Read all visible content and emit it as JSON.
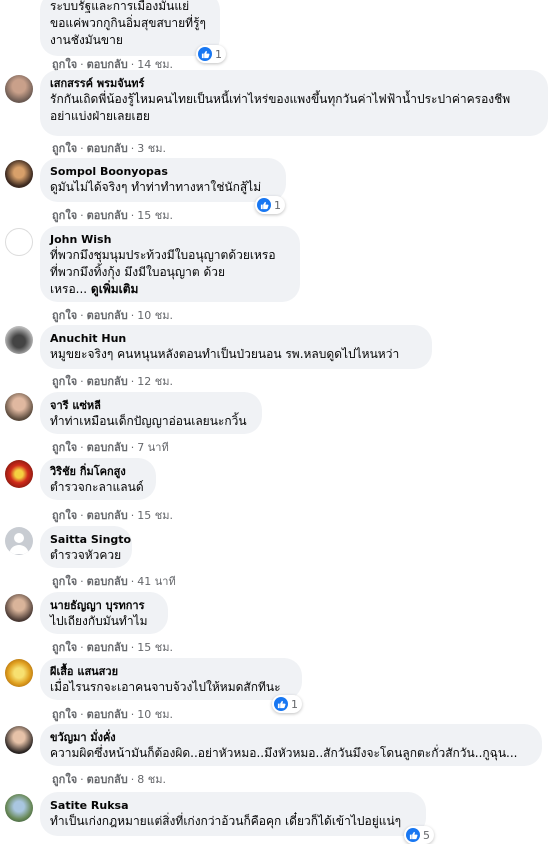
{
  "actions": {
    "like": "ถูกใจ",
    "reply": "ตอบกลับ",
    "dot": "·"
  },
  "comments": [
    {
      "name": "",
      "text": "ระบบรัฐและการเมืองมันแย่\nขอแค่พวกกูกินอิ่มสุขสบายที่รู้ๆ\nงานชังมันขาย",
      "time": "14 ชม.",
      "reactions": "1"
    },
    {
      "name": "เสกสรรค์ พรมจันทร์",
      "text": "รักกันเถิดพี่น้องรู้ไหมคนไทยเป็นหนี้เท่าไหร่ของแพงขึ้นทุกวันค่าไฟฟ้าน้ำประปาค่าครองชีพ\nอย่าแบ่งฝ่ายเลยเฮย",
      "time": "3 ชม."
    },
    {
      "name": "Sompol Boonyopas",
      "text": "ดูมันไม่ได้จริงๆ ทำท่าทำทางหาใช่นักสู้ไม่",
      "time": "15 ชม.",
      "reactions": "1"
    },
    {
      "name": "John Wish",
      "text": "ที่พวกมึงชุมนุมประท้วงมีใบอนุญาตด้วยเหรอ\nที่พวกมึงทิ้งกุ้ง มึงมีใบอนุญาต ด้วย\nเหรอ... ",
      "more": "ดูเพิ่มเติม",
      "time": "10 ชม."
    },
    {
      "name": "Anuchit Hun",
      "text": "หมูขยะจริงๆ คนหนุนหลังตอนทำเป็นป่วยนอน รพ.หลบดูดไปไหนหว่า",
      "time": "12 ชม."
    },
    {
      "name": "จารี แซ่หลี",
      "text": "ทำท่าเหมือนเด็กปัญญาอ่อนเลยนะกวิ้น",
      "time": "7 นาที"
    },
    {
      "name": "วิริชัย กิ่มโคกสูง",
      "text": "ตำรวจกะลาแลนด์",
      "time": "15 ชม."
    },
    {
      "name": "Saitta Singto",
      "text": "ตำรวจหัวควย",
      "time": "41 นาที"
    },
    {
      "name": "นายธัญญา บุรทการ",
      "text": "ไปเถียงกับมันทำไม",
      "time": "15 ชม."
    },
    {
      "name": "ผีเสื้อ แสนสวย",
      "text": "เมื่อไรนรกจะเอาคนจาบจ้วงไปให้หมดสักทีนะ",
      "time": "10 ชม.",
      "reactions": "1"
    },
    {
      "name": "ขวัญมา มั่งคั่ง",
      "text": "ความผิดซึ่งหน้ามันก็ต้องผิด..อย่าหัวหมอ..มึงหัวหมอ..สักวันมึงจะโดนลูกตะกั่วสักวัน..กูฉุน...",
      "time": "8 ชม."
    },
    {
      "name": "Satite Ruksa",
      "text": "ทำเป็นเก่งกฎหมายแต่สิ่งที่เก่งกว่าอ้วนก็คือคุก เดี๋ยวก็ได้เข้าไปอยู่แน่ๆ",
      "time": "",
      "reactions": "5"
    }
  ],
  "colors": {
    "bubble": "#f0f2f5",
    "meta": "#65676b",
    "like_blue": "#1877f2"
  }
}
